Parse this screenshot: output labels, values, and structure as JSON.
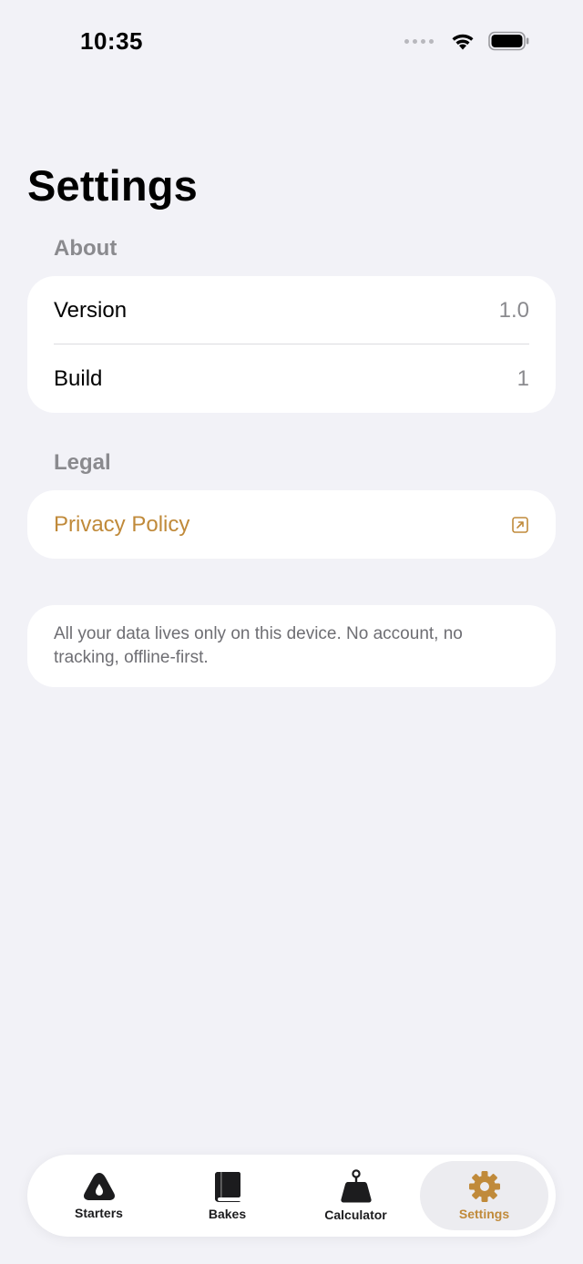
{
  "status_bar": {
    "time": "10:35"
  },
  "page": {
    "title": "Settings"
  },
  "sections": {
    "about": {
      "header": "About",
      "rows": [
        {
          "label": "Version",
          "value": "1.0"
        },
        {
          "label": "Build",
          "value": "1"
        }
      ]
    },
    "legal": {
      "header": "Legal",
      "privacy_label": "Privacy Policy",
      "privacy_icon": "external-link-icon"
    },
    "note": {
      "text": "All your data lives only on this device. No account, no tracking, offline-first."
    }
  },
  "tab_bar": {
    "tabs": [
      {
        "label": "Starters",
        "icon": "drop-icon",
        "active": false
      },
      {
        "label": "Bakes",
        "icon": "book-icon",
        "active": false
      },
      {
        "label": "Calculator",
        "icon": "scale-weight-icon",
        "active": false
      },
      {
        "label": "Settings",
        "icon": "gear-icon",
        "active": true
      }
    ]
  },
  "colors": {
    "accent": "#c08a3a",
    "background": "#f2f2f7",
    "card": "#ffffff",
    "secondary_text": "#8a8a8e"
  }
}
